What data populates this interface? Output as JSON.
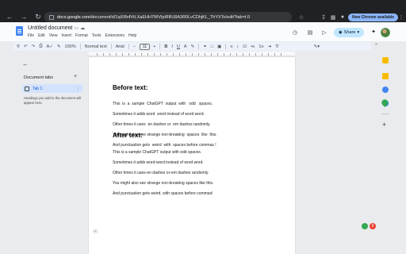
{
  "browser": {
    "url_host": "docs.google.com",
    "url_path": "/document/d/1qXI8nfVtLXaEHH7WVIpiRBU8A3R0LvCDhjKL_ThYXTo/edit?tab=t.0",
    "new_chrome_label": "New Chrome available"
  },
  "docs": {
    "title": "Untitled document",
    "menu": [
      "File",
      "Edit",
      "View",
      "Insert",
      "Format",
      "Tools",
      "Extensions",
      "Help"
    ],
    "share_label": "Share"
  },
  "toolbar": {
    "zoom": "100%",
    "style": "Normal text",
    "font": "Arial",
    "font_size": "11"
  },
  "side_panel": {
    "header": "Document tabs",
    "tab_label": "Tab 1",
    "hint": "Headings you add to the document will appear here."
  },
  "document": {
    "before_heading": "Before text:",
    "after_heading": "After text:",
    "before_lines": [
      "This  is  a  sample  ChatGPT  output  with   odd   spaces.",
      "Sometimes it adds word  word instead of word word.",
      "Other times it uses  en dashes or  em dashes randomly.",
      "You might also see strange non-breaking  spaces  like  this.",
      "And punctuation gets  weird  with  spaces before commas !"
    ],
    "after_lines": [
      "This is a sample ChatGPT output with odd spaces.",
      "Sometimes it adds word-word instead of word word.",
      "Other times it uses-en dashes or-em dashes randomly.",
      "You might also see strange non-breaking spaces like this.",
      "And punctuation gets weird, with spaces before commas!"
    ]
  },
  "notifications": {
    "badge": "9"
  },
  "colors": {
    "chrome_dark": "#202124",
    "share_blue": "#c2e7ff",
    "tab_active": "#d3e3fd",
    "accent_blue": "#0b57d0"
  }
}
